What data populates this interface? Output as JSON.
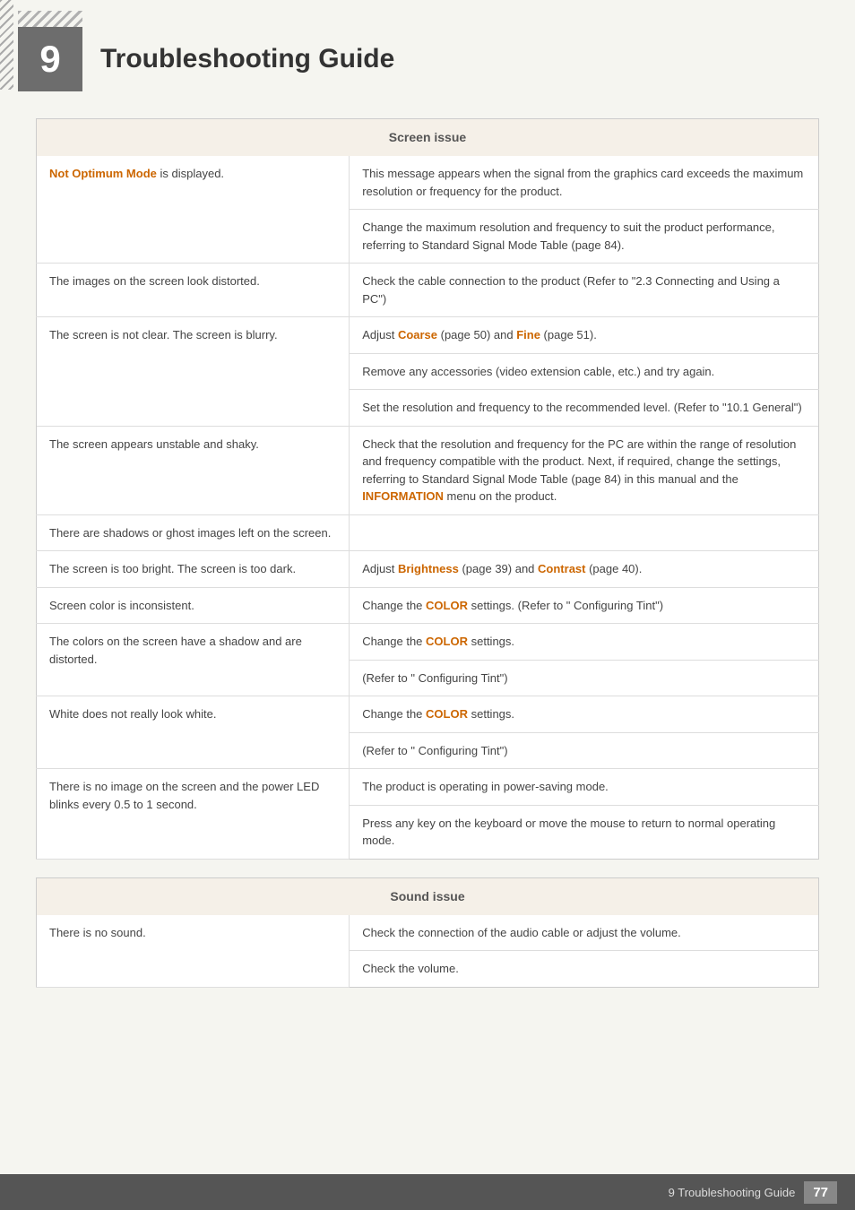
{
  "header": {
    "chapter_number": "9",
    "title": "Troubleshooting Guide"
  },
  "screen_issue": {
    "section_title": "Screen issue",
    "rows": [
      {
        "problem": "<span class='highlight-orange'>Not Optimum Mode</span> is displayed.",
        "solution": "This message appears when the signal from the graphics card exceeds the maximum resolution or frequency for the product."
      },
      {
        "problem": "",
        "solution": "Change the maximum resolution and frequency to suit the product performance, referring to Standard Signal Mode Table (page 84)."
      },
      {
        "problem": "The images on the screen look distorted.",
        "solution": "Check the cable connection to the product (Refer to \"2.3 Connecting and Using a PC\")"
      },
      {
        "problem": "The screen is not clear. The screen is blurry.",
        "solution": "Adjust <span class='highlight-orange'>Coarse</span> (page 50) and <span class='highlight-orange'>Fine</span> (page 51)."
      },
      {
        "problem": "",
        "solution": "Remove any accessories (video extension cable, etc.) and try again."
      },
      {
        "problem": "",
        "solution": "Set the resolution and frequency to the recommended level. (Refer to \"10.1 General\")"
      },
      {
        "problem": "The screen appears unstable and shaky.",
        "solution_combined": "Check that the resolution and frequency for the PC are within the range of resolution and frequency compatible with the product. Next, if required, change the settings, referring to Standard Signal Mode Table (page 84) in this manual and the <span class='highlight-orange'>INFORMATION</span> menu on the product."
      },
      {
        "problem": "There are shadows or ghost images left on the screen.",
        "solution_combined": null
      },
      {
        "problem": "The screen is too bright. The screen is too dark.",
        "solution": "Adjust <span class='highlight-orange'>Brightness</span> (page 39) and <span class='highlight-orange'>Contrast</span> (page 40)."
      },
      {
        "problem": "Screen color is inconsistent.",
        "solution": "Change the <span class='highlight-orange'>COLOR</span> settings. (Refer to \" Configuring Tint\")"
      },
      {
        "problem": "The colors on the screen have a shadow and are distorted.",
        "solution1": "Change the <span class='highlight-orange'>COLOR</span> settings.",
        "solution2": "(Refer to \" Configuring Tint\")"
      },
      {
        "problem": "White does not really look white.",
        "solution1": "Change the <span class='highlight-orange'>COLOR</span> settings.",
        "solution2": "(Refer to \" Configuring Tint\")"
      },
      {
        "problem": "There is no image on the screen and the power LED blinks every 0.5 to 1 second.",
        "solution1": "The product is operating in power-saving mode.",
        "solution2": "Press any key on the keyboard or move the mouse to return to normal operating mode."
      }
    ]
  },
  "sound_issue": {
    "section_title": "Sound issue",
    "rows": [
      {
        "problem": "There is no sound.",
        "solution1": "Check the connection of the audio cable or adjust the volume.",
        "solution2": "Check the volume."
      }
    ]
  },
  "footer": {
    "label": "9 Troubleshooting Guide",
    "page": "77"
  }
}
